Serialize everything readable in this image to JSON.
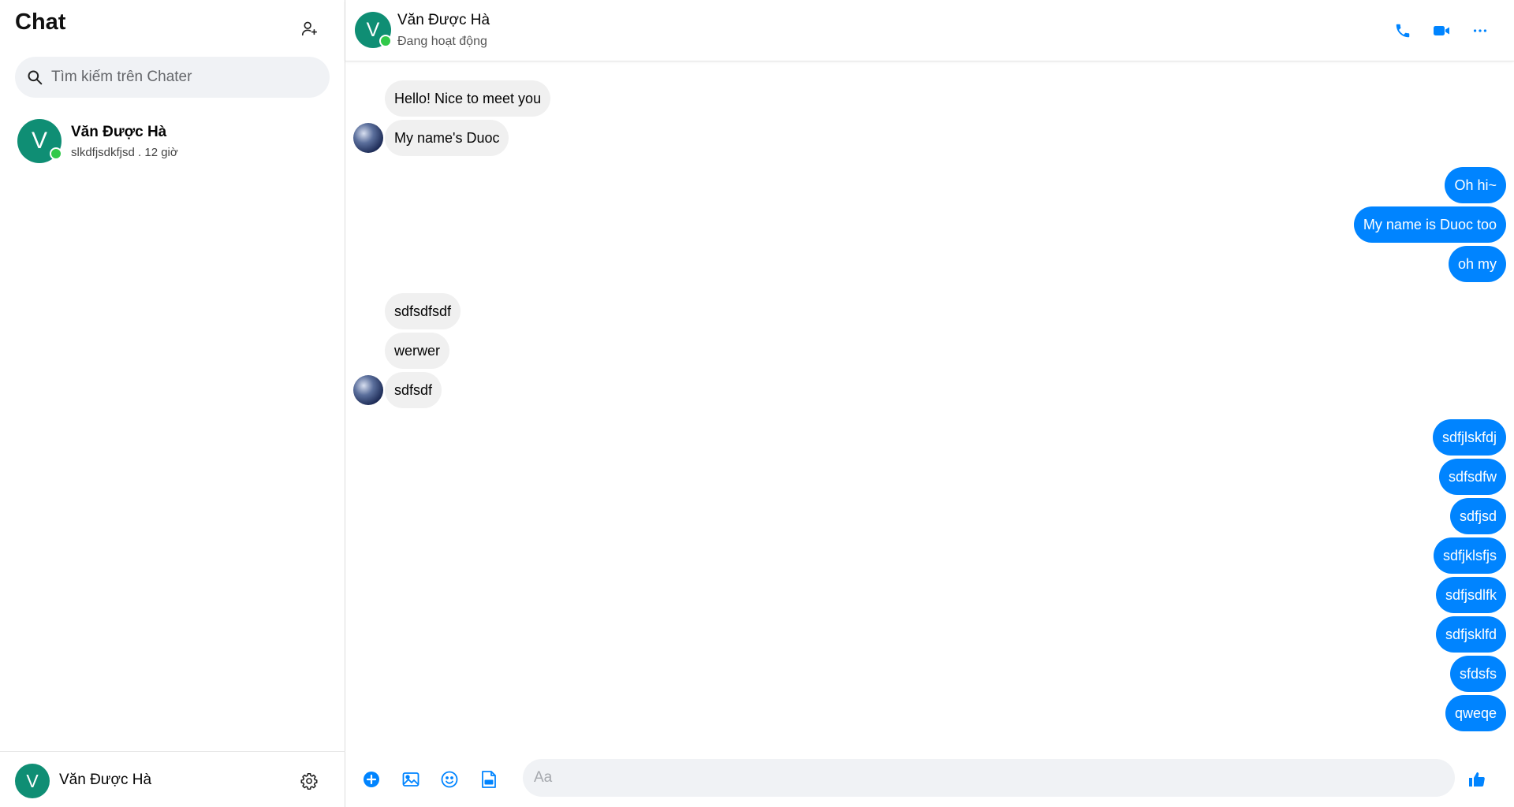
{
  "sidebar": {
    "title": "Chat",
    "search_placeholder": "Tìm kiếm trên Chater",
    "conversations": [
      {
        "avatar_letter": "V",
        "name": "Văn Được Hà",
        "preview": "slkdfjsdkfjsd . 12 giờ",
        "online": true
      }
    ],
    "footer": {
      "avatar_letter": "V",
      "name": "Văn Được Hà"
    }
  },
  "chat_header": {
    "avatar_letter": "V",
    "name": "Văn Được Hà",
    "status": "Đang hoạt động"
  },
  "messages": [
    {
      "side": "in",
      "text": "Hello! Nice to meet you"
    },
    {
      "side": "in",
      "text": "My name's Duoc"
    },
    {
      "side": "out",
      "text": "Oh hi~"
    },
    {
      "side": "out",
      "text": "My name is Duoc too"
    },
    {
      "side": "out",
      "text": "oh my"
    },
    {
      "side": "in",
      "text": "sdfsdfsdf"
    },
    {
      "side": "in",
      "text": "werwer"
    },
    {
      "side": "in",
      "text": "sdfsdf"
    },
    {
      "side": "out",
      "text": "sdfjlskfdj"
    },
    {
      "side": "out",
      "text": "sdfsdfw"
    },
    {
      "side": "out",
      "text": "sdfjsd"
    },
    {
      "side": "out",
      "text": "sdfjklsfjs"
    },
    {
      "side": "out",
      "text": "sdfjsdlfk"
    },
    {
      "side": "out",
      "text": "sdfjsklfd"
    },
    {
      "side": "out",
      "text": "sfdsfs"
    },
    {
      "side": "out",
      "text": "qweqe"
    }
  ],
  "composer": {
    "placeholder": "Aa"
  },
  "colors": {
    "accent": "#0084ff",
    "avatar_bg": "#0f8e74",
    "online": "#31c94a",
    "incoming_bubble": "#f0f0f0"
  },
  "icons": {
    "add_user": "add-user-icon",
    "search": "search-icon",
    "settings": "gear-icon",
    "call": "phone-icon",
    "video": "video-camera-icon",
    "more": "more-dots-icon",
    "add": "plus-circle-icon",
    "image": "image-icon",
    "emoji": "emoji-icon",
    "gif": "gif-file-icon",
    "like": "thumbs-up-icon"
  }
}
